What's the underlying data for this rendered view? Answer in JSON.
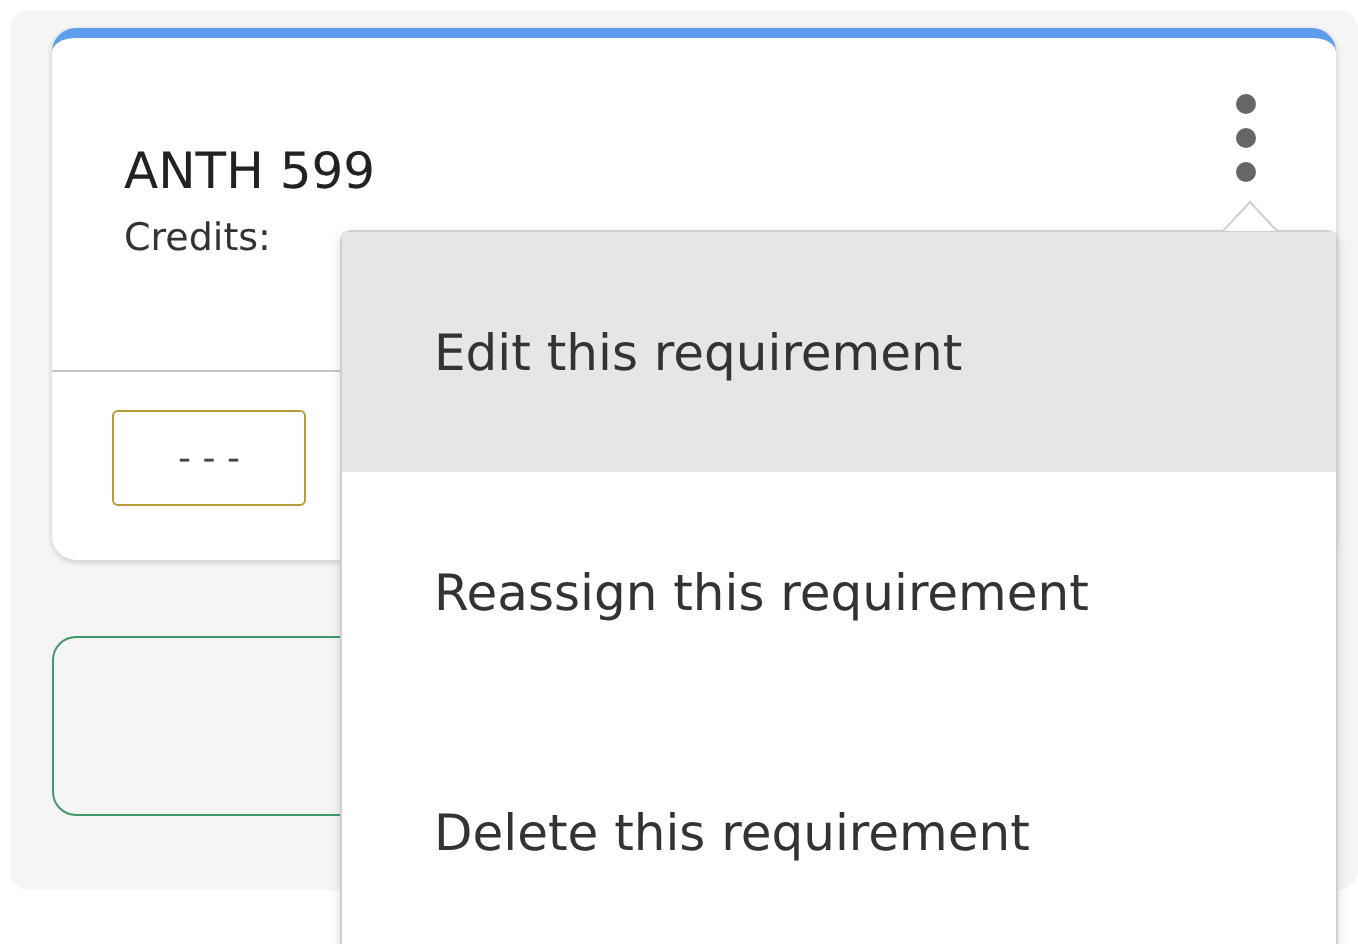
{
  "card": {
    "title": "ANTH 599",
    "credits_label": "Credits:",
    "grade": "- - -"
  },
  "menu": {
    "items": [
      {
        "label": "Edit this requirement",
        "selected": true
      },
      {
        "label": "Reassign this requirement",
        "selected": false
      },
      {
        "label": "Delete this requirement",
        "selected": false
      }
    ]
  }
}
